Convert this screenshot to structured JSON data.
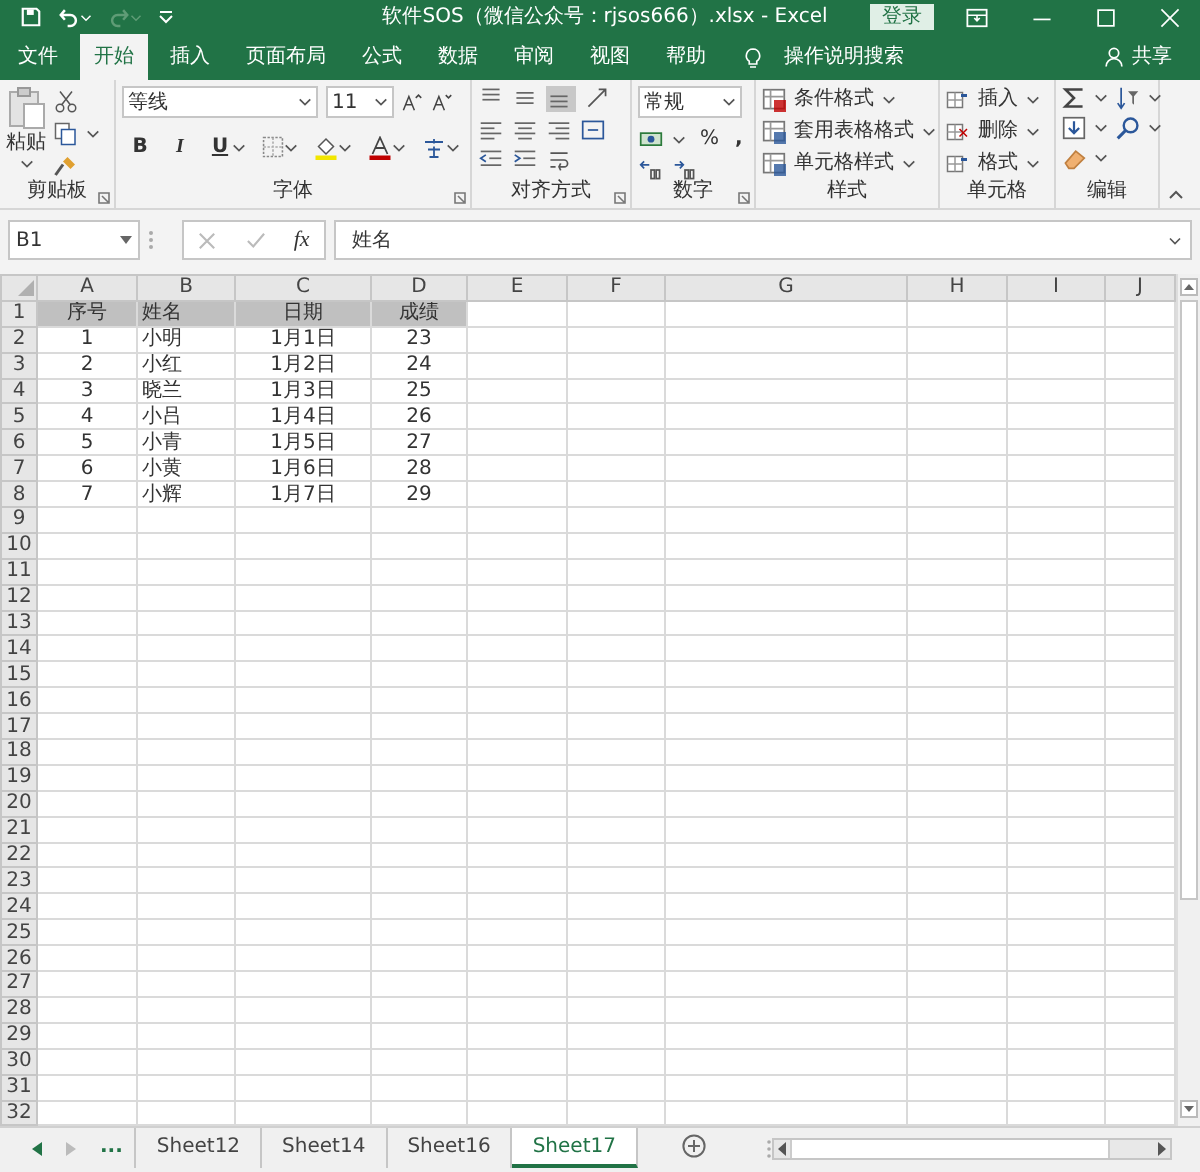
{
  "window": {
    "title": "软件SOS（微信公众号：rjsos666）.xlsx - Excel",
    "login": "登录"
  },
  "tabs": [
    {
      "label": "文件",
      "selected": false
    },
    {
      "label": "开始",
      "selected": true
    },
    {
      "label": "插入",
      "selected": false
    },
    {
      "label": "页面布局",
      "selected": false
    },
    {
      "label": "公式",
      "selected": false
    },
    {
      "label": "数据",
      "selected": false
    },
    {
      "label": "审阅",
      "selected": false
    },
    {
      "label": "视图",
      "selected": false
    },
    {
      "label": "帮助",
      "selected": false
    }
  ],
  "tell_me": "操作说明搜索",
  "share": "共享",
  "ribbon": {
    "clipboard": {
      "paste": "粘贴",
      "group_label": "剪贴板"
    },
    "font": {
      "font_name": "等线",
      "font_size": "11",
      "bold": "B",
      "italic": "I",
      "underline": "U",
      "group_label": "字体"
    },
    "alignment": {
      "bottom_aligned": true,
      "group_label": "对齐方式"
    },
    "number": {
      "format": "常规",
      "percent": "%",
      "comma": ",",
      "group_label": "数字"
    },
    "styles": {
      "buttons": [
        "条件格式",
        "套用表格格式",
        "单元格样式"
      ],
      "group_label": "样式"
    },
    "cells": {
      "buttons": [
        "插入",
        "删除",
        "格式"
      ],
      "group_label": "单元格"
    },
    "editing": {
      "group_label": "编辑"
    }
  },
  "formula_bar": {
    "name_box": "B1",
    "function_label": "fx",
    "value": "姓名"
  },
  "grid": {
    "columns": [
      "A",
      "B",
      "C",
      "D",
      "E",
      "F",
      "G",
      "H",
      "I",
      "J"
    ],
    "row_numbers": [
      "1",
      "2",
      "3",
      "4",
      "5",
      "6",
      "7",
      "8",
      "9",
      "10",
      "11",
      "12",
      "13",
      "14",
      "15",
      "16",
      "17",
      "18",
      "19",
      "20",
      "21",
      "22",
      "23",
      "24",
      "25",
      "26",
      "27",
      "28",
      "29",
      "30",
      "31",
      "32"
    ],
    "rows": [
      {
        "shaded": true,
        "cells": [
          "序号",
          "姓名",
          "日期",
          "成绩"
        ]
      },
      {
        "shaded": false,
        "cells": [
          "1",
          "小明",
          "1月1日",
          "23"
        ]
      },
      {
        "shaded": false,
        "cells": [
          "2",
          "小红",
          "1月2日",
          "24"
        ]
      },
      {
        "shaded": false,
        "cells": [
          "3",
          "晓兰",
          "1月3日",
          "25"
        ]
      },
      {
        "shaded": false,
        "cells": [
          "4",
          "小吕",
          "1月4日",
          "26"
        ]
      },
      {
        "shaded": false,
        "cells": [
          "5",
          "小青",
          "1月5日",
          "27"
        ]
      },
      {
        "shaded": false,
        "cells": [
          "6",
          "小黄",
          "1月6日",
          "28"
        ]
      },
      {
        "shaded": false,
        "cells": [
          "7",
          "小辉",
          "1月7日",
          "29"
        ]
      }
    ]
  },
  "sheet_overflow": "...",
  "sheets": [
    {
      "label": "Sheet12",
      "selected": false
    },
    {
      "label": "Sheet14",
      "selected": false
    },
    {
      "label": "Sheet16",
      "selected": false
    },
    {
      "label": "Sheet17",
      "selected": true
    }
  ]
}
